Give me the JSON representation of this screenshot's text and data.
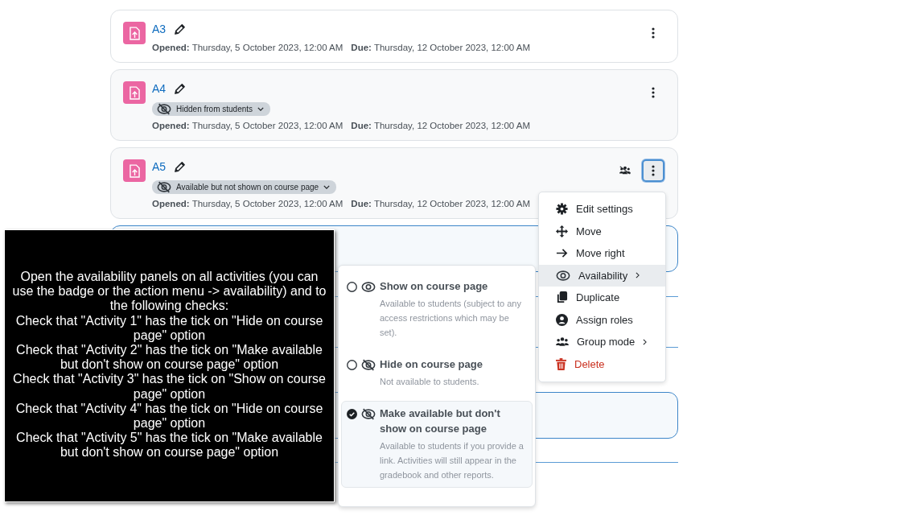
{
  "activities": [
    {
      "name": "A3",
      "opened": "**Opened:** Thursday, 5 October 2023, 12:00 AM",
      "due": "**Due:** Thursday, 12 October 2023, 12:00 AM",
      "group_mode": false,
      "menu_open": false
    },
    {
      "name": "A4",
      "badge": "Hidden from students",
      "opened": "**Opened:** Thursday, 5 October 2023, 12:00 AM",
      "due": "**Due:** Thursday, 12 October 2023, 12:00 AM",
      "group_mode": false,
      "menu_open": false
    },
    {
      "name": "A5",
      "badge": "Available but not shown on course page",
      "opened": "**Opened:** Thursday, 5 October 2023, 12:00 AM",
      "due": "**Due:** Thursday, 12 October 2023, 12:00 AM",
      "group_mode": true,
      "menu_open": true
    }
  ],
  "action_menu": {
    "items": [
      {
        "label": "Edit settings",
        "kind": "settings",
        "submenu": false,
        "highlighted": false
      },
      {
        "label": "Move",
        "kind": "move",
        "submenu": false,
        "highlighted": false
      },
      {
        "label": "Move right",
        "kind": "move-right",
        "submenu": false,
        "highlighted": false
      },
      {
        "label": "Availability",
        "kind": "availability",
        "submenu": true,
        "highlighted": true
      },
      {
        "label": "Duplicate",
        "kind": "duplicate",
        "submenu": false,
        "highlighted": false
      },
      {
        "label": "Assign roles",
        "kind": "roles",
        "submenu": false,
        "highlighted": false
      },
      {
        "label": "Group mode",
        "kind": "group",
        "submenu": true,
        "highlighted": false
      },
      {
        "label": "Delete",
        "kind": "delete",
        "submenu": false,
        "highlighted": false
      }
    ]
  },
  "availability_panel": {
    "options": [
      {
        "kind": "show",
        "title": "Show on course page",
        "description": "Available to students (subject to any access restrictions which may be set).",
        "selected": false
      },
      {
        "kind": "hide",
        "title": "Hide on course page",
        "description": "Not available to students.",
        "selected": false
      },
      {
        "kind": "stealth",
        "title": "Make available but don't show on course page",
        "description": "Available to students if you provide a link. Activities will still appear in the gradebook and other reports.",
        "selected": true
      }
    ]
  },
  "instructions": {
    "lines": [
      "Open the availability panels on all activities (you can use the badge or the action menu -> availability) and to the following checks:",
      "Check that \"Activity 1\" has the tick on \"Hide on course page\" option",
      "Check that \"Activity 2\" has the tick on \"Make available but don't show on course page\" option",
      "Check that \"Activity 3\" has the tick on \"Show on course page\" option",
      "Check that \"Activity 4\" has the tick on \"Hide on course page\" option",
      "Check that \"Activity 5\" has the tick on \"Make available but don't show on course page\" option"
    ]
  }
}
